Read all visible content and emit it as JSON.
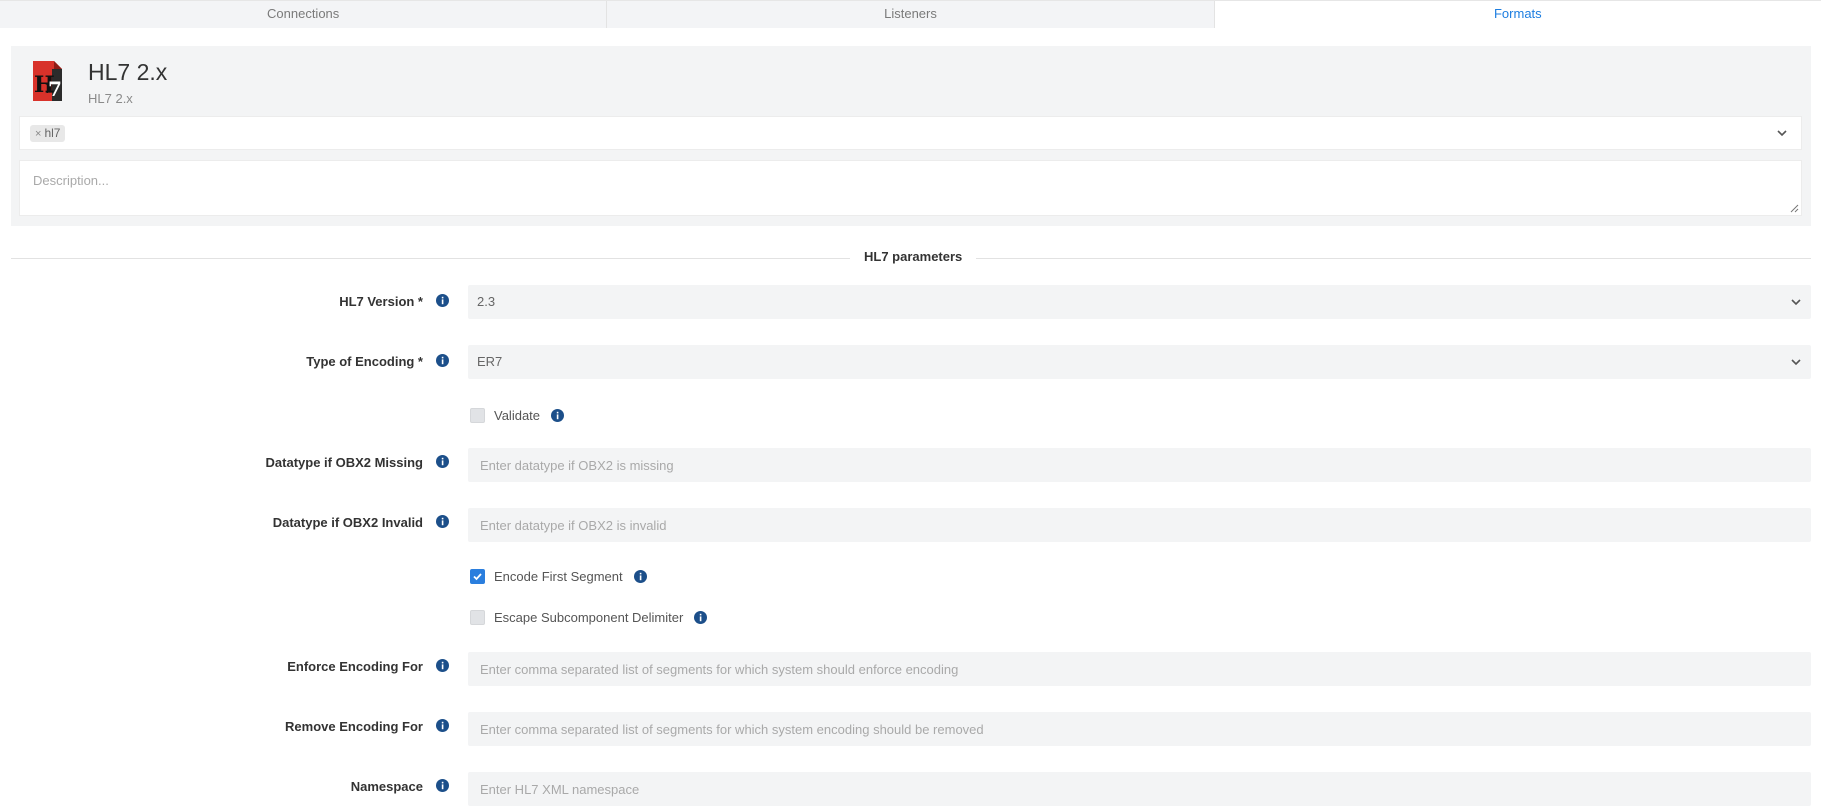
{
  "tabs": [
    {
      "label": "Connections",
      "active": false
    },
    {
      "label": "Listeners",
      "active": false
    },
    {
      "label": "Formats",
      "active": true
    }
  ],
  "format": {
    "title": "HL7 2.x",
    "subtitle": "HL7 2.x",
    "logo_text": "HL7",
    "tags": [
      "hl7"
    ],
    "description_placeholder": "Description..."
  },
  "section": {
    "title": "HL7 parameters"
  },
  "fields": {
    "hl7_version": {
      "label": "HL7 Version *",
      "value": "2.3"
    },
    "encoding": {
      "label": "Type of Encoding *",
      "value": "ER7"
    },
    "validate": {
      "label": "Validate",
      "checked": false
    },
    "obx2_missing": {
      "label": "Datatype if OBX2 Missing",
      "placeholder": "Enter datatype if OBX2 is missing"
    },
    "obx2_invalid": {
      "label": "Datatype if OBX2 Invalid",
      "placeholder": "Enter datatype if OBX2 is invalid"
    },
    "encode_first_segment": {
      "label": "Encode First Segment",
      "checked": true
    },
    "escape_subcomponent": {
      "label": "Escape Subcomponent Delimiter",
      "checked": false
    },
    "enforce_encoding": {
      "label": "Enforce Encoding For",
      "placeholder": "Enter comma separated list of segments for which system should enforce encoding"
    },
    "remove_encoding": {
      "label": "Remove Encoding For",
      "placeholder": "Enter comma separated list of segments for which system encoding should be removed"
    },
    "namespace": {
      "label": "Namespace",
      "placeholder": "Enter HL7 XML namespace"
    }
  },
  "colors": {
    "accent": "#1e7ee0",
    "info_icon": "#1c4f8a",
    "logo_red": "#d8322a"
  }
}
